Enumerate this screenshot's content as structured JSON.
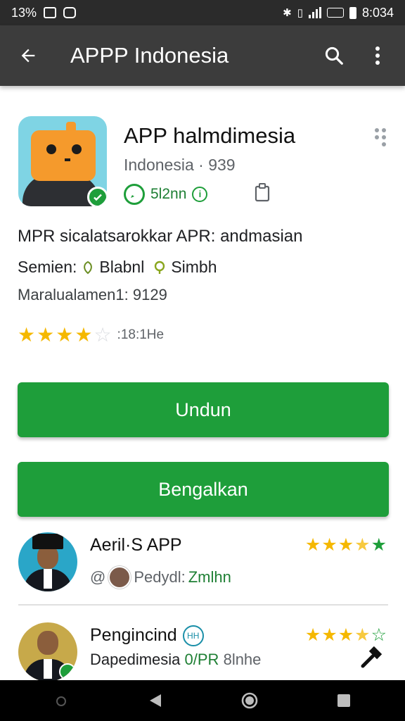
{
  "status_bar": {
    "battery_percent": "13%",
    "time": "8:034"
  },
  "app_bar": {
    "title": "APPP Indonesia",
    "icons": [
      "back-arrow-icon",
      "search-icon",
      "more-vert-icon"
    ]
  },
  "app": {
    "name": "APP halmdimesia",
    "developer": "Indonesia · 939",
    "size": "5l2nn",
    "description": "MPR sicalatsarokkar APR: andmasian",
    "version_label": "Semien:",
    "version_value_a": "Blabnl",
    "version_value_b": "Simbh",
    "stat": "Maralualamen1: 9129",
    "rating": 4,
    "rating_max": 5,
    "rating_text": ":18:1He",
    "colors": {
      "accent": "#1e9e3a",
      "star": "#f5b800",
      "app_bar": "#3c3c3c"
    }
  },
  "actions": {
    "install_label": "Undun",
    "open_label": "Bengalkan"
  },
  "reviews": [
    {
      "name": "Aeril·S APP",
      "sub_prefix": "@",
      "sub_text": "Pedydl:",
      "time": "Zmlhn",
      "stars": 3.5
    },
    {
      "name": "Pengincind",
      "badge_text": "HH",
      "line_text": "Dapedimesia",
      "line_tag": "0/PR",
      "line_suffix": "8lnhe",
      "stars": 3.5
    }
  ]
}
